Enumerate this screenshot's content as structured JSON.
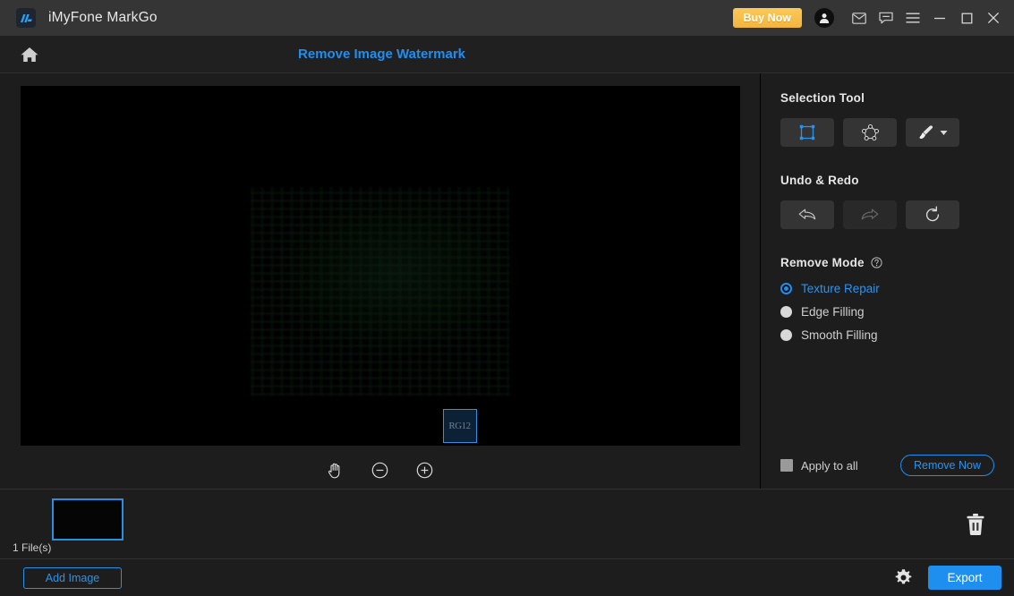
{
  "titlebar": {
    "logo_icon": "markgo-logo-icon",
    "app_title": "iMyFone MarkGo",
    "buy_now_label": "Buy Now",
    "icons": {
      "account": "account-avatar-icon",
      "mail": "mail-icon",
      "feedback": "feedback-icon",
      "menu": "hamburger-menu-icon",
      "minimize": "minimize-icon",
      "maximize": "maximize-icon",
      "close": "close-icon"
    }
  },
  "subheader": {
    "home_icon": "home-icon",
    "page_title": "Remove Image Watermark"
  },
  "editor": {
    "selection_watermark_text": "RG12",
    "canvas_tools": [
      {
        "name": "pan-hand-tool",
        "icon": "hand-icon"
      },
      {
        "name": "zoom-out-tool",
        "icon": "minus-circle-icon"
      },
      {
        "name": "zoom-in-tool",
        "icon": "plus-circle-icon"
      }
    ]
  },
  "panel": {
    "selection_tool": {
      "title": "Selection Tool",
      "tools": [
        {
          "name": "rectangle-select-tool",
          "icon": "rectangle-select-icon",
          "active": true
        },
        {
          "name": "polygon-select-tool",
          "icon": "polygon-select-icon",
          "active": false
        },
        {
          "name": "brush-select-tool",
          "icon": "brush-icon",
          "active": false
        }
      ]
    },
    "undo_redo": {
      "title": "Undo & Redo",
      "buttons": [
        {
          "name": "undo-button",
          "icon": "undo-arrow-icon"
        },
        {
          "name": "redo-button",
          "icon": "redo-arrow-icon"
        },
        {
          "name": "reset-button",
          "icon": "refresh-icon"
        }
      ]
    },
    "remove_mode": {
      "title": "Remove Mode",
      "help_icon": "help-circle-icon",
      "options": [
        {
          "label": "Texture Repair",
          "selected": true
        },
        {
          "label": "Edge Filling",
          "selected": false
        },
        {
          "label": "Smooth Filling",
          "selected": false
        }
      ]
    },
    "apply_to_all_label": "Apply to all",
    "apply_to_all_checked": false,
    "remove_now_label": "Remove Now"
  },
  "filmstrip": {
    "file_count_label": "1 File(s)",
    "delete_icon": "trash-icon"
  },
  "footer": {
    "add_image_label": "Add Image",
    "settings_icon": "gear-icon",
    "export_label": "Export"
  },
  "colors": {
    "accent_blue": "#1f8fef",
    "buy_now_amber": "#f2b53d",
    "panel_bg": "#1d1d1d",
    "titlebar_bg": "#353535"
  }
}
